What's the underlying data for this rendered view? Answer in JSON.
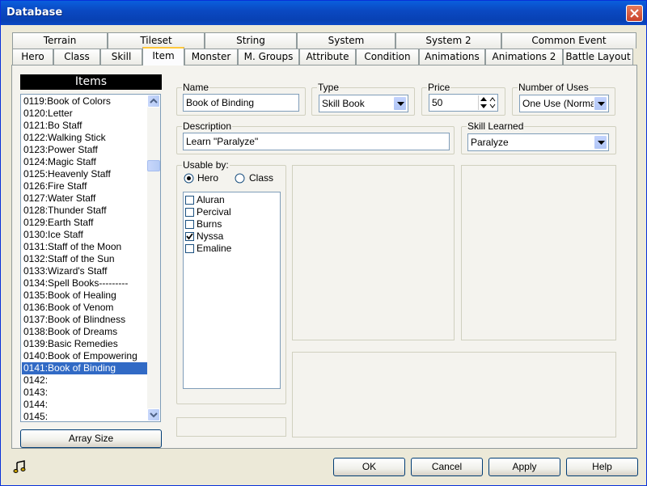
{
  "window": {
    "title": "Database"
  },
  "tabs_row1": [
    "Terrain",
    "Tileset",
    "String",
    "System",
    "System 2",
    "Common Event"
  ],
  "tabs_row2": [
    "Hero",
    "Class",
    "Skill",
    "Item",
    "Monster",
    "M. Groups",
    "Attribute",
    "Condition",
    "Animations",
    "Animations 2",
    "Battle Layout"
  ],
  "active_tab": "Item",
  "items": {
    "header": "Items",
    "list": [
      "0119:Book of Colors",
      "0120:Letter",
      "0121:Bo Staff",
      "0122:Walking Stick",
      "0123:Power Staff",
      "0124:Magic Staff",
      "0125:Heavenly Staff",
      "0126:Fire Staff",
      "0127:Water Staff",
      "0128:Thunder Staff",
      "0129:Earth Staff",
      "0130:Ice Staff",
      "0131:Staff of the Moon",
      "0132:Staff of the Sun",
      "0133:Wizard's Staff",
      "0134:Spell Books---------",
      "0135:Book of Healing",
      "0136:Book of Venom",
      "0137:Book of Blindness",
      "0138:Book of Dreams",
      "0139:Basic Remedies",
      "0140:Book of Empowering",
      "0141:Book of Binding",
      "0142:",
      "0143:",
      "0144:",
      "0145:"
    ],
    "selected": "0141:Book of Binding",
    "array_size_label": "Array Size"
  },
  "form": {
    "name_label": "Name",
    "name_value": "Book of Binding",
    "type_label": "Type",
    "type_value": "Skill Book",
    "price_label": "Price",
    "price_value": "50",
    "uses_label": "Number of Uses",
    "uses_value": "One Use (Normal)",
    "description_label": "Description",
    "description_value": "Learn \"Paralyze\"",
    "skill_label": "Skill Learned",
    "skill_value": "Paralyze",
    "usable_label": "Usable by:",
    "radio_hero": "Hero",
    "radio_class": "Class",
    "heroes": [
      {
        "name": "Aluran",
        "checked": false
      },
      {
        "name": "Percival",
        "checked": false
      },
      {
        "name": "Burns",
        "checked": false
      },
      {
        "name": "Nyssa",
        "checked": true
      },
      {
        "name": "Emaline",
        "checked": false
      }
    ]
  },
  "footer": {
    "ok": "OK",
    "cancel": "Cancel",
    "apply": "Apply",
    "help": "Help",
    "music_icon": "music-note-icon"
  },
  "colors": {
    "title_bar": "#0A49C2",
    "selection": "#316AC5",
    "active_tab_top": "#FFC83C"
  }
}
